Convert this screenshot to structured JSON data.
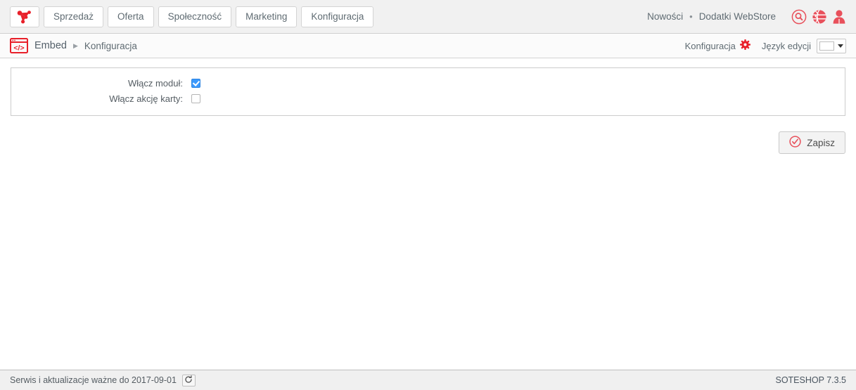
{
  "topnav": {
    "logo_icon": "soteshop-logo-icon",
    "items": [
      {
        "label": "Sprzedaż"
      },
      {
        "label": "Oferta"
      },
      {
        "label": "Społeczność"
      },
      {
        "label": "Marketing"
      },
      {
        "label": "Konfiguracja"
      }
    ],
    "right_links": [
      {
        "label": "Nowości"
      },
      {
        "label": "Dodatki WebStore"
      }
    ],
    "separator": "•",
    "icons": [
      {
        "name": "search-icon"
      },
      {
        "name": "globe-icon"
      },
      {
        "name": "user-icon"
      }
    ]
  },
  "breadcrumb": {
    "module_icon": "embed-code-icon",
    "module": "Embed",
    "arrow": "▶",
    "current": "Konfiguracja",
    "config_label": "Konfiguracja",
    "gear_icon": "gear-icon",
    "lang_label": "Język edycji",
    "lang_flag": "poland-flag-icon"
  },
  "form": {
    "rows": [
      {
        "label": "Włącz moduł:",
        "checked": true
      },
      {
        "label": "Włącz akcję karty:",
        "checked": false
      }
    ]
  },
  "actions": {
    "save_label": "Zapisz",
    "save_icon": "check-circle-icon"
  },
  "footer": {
    "service_text": "Serwis i aktualizacje ważne do 2017-09-01",
    "refresh_icon": "refresh-icon",
    "version": "SOTESHOP 7.3.5"
  },
  "colors": {
    "brand_red": "#e8505b",
    "logo_red": "#e8202a",
    "checkbox_blue": "#3b99fc",
    "header_bg": "#f1f1f1",
    "footer_bg": "#f0f0f0"
  }
}
